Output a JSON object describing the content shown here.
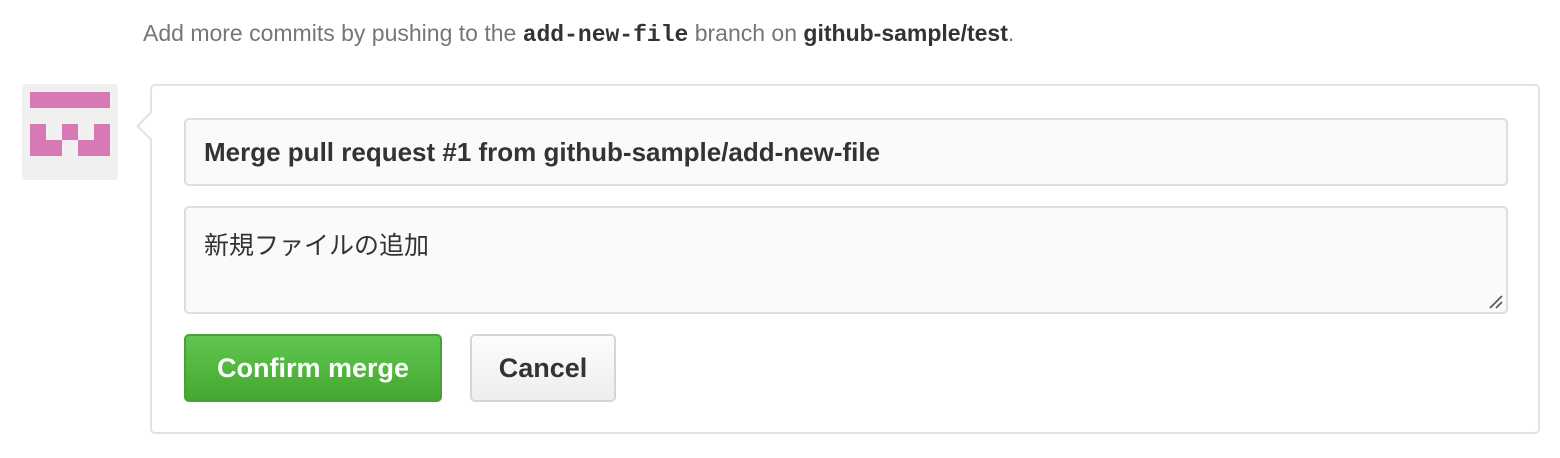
{
  "hint": {
    "prefix": "Add more commits by pushing to the ",
    "branch": "add-new-file",
    "middle": " branch on ",
    "repo": "github-sample/test",
    "suffix": "."
  },
  "merge_form": {
    "title_value": "Merge pull request #1 from github-sample/add-new-file",
    "body_value": "新規ファイルの追加",
    "confirm_label": "Confirm merge",
    "cancel_label": "Cancel"
  },
  "colors": {
    "confirm_button": "#55b83f",
    "avatar_identicon": "#d879b6",
    "avatar_background": "#f0f0f0"
  }
}
